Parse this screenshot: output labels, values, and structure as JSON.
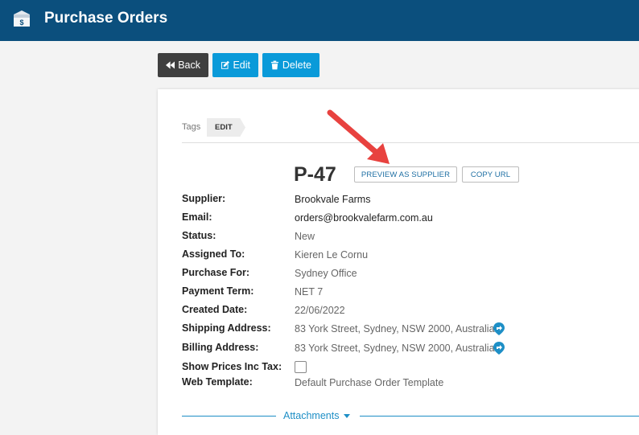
{
  "header": {
    "title": "Purchase Orders",
    "icon": "dollar-box-icon"
  },
  "toolbar": {
    "back_label": "Back",
    "edit_label": "Edit",
    "delete_label": "Delete"
  },
  "tags": {
    "label": "Tags",
    "edit_label": "EDIT"
  },
  "order": {
    "number": "P-47",
    "preview_label": "PREVIEW AS SUPPLIER",
    "copy_url_label": "COPY URL"
  },
  "fields": {
    "supplier": {
      "label": "Supplier:",
      "value": "Brookvale Farms"
    },
    "email": {
      "label": "Email:",
      "value": "orders@brookvalefarm.com.au"
    },
    "status": {
      "label": "Status:",
      "value": "New"
    },
    "assigned_to": {
      "label": "Assigned To:",
      "value": "Kieren Le Cornu"
    },
    "purchase_for": {
      "label": "Purchase For:",
      "value": "Sydney Office"
    },
    "payment_term": {
      "label": "Payment Term:",
      "value": "NET 7"
    },
    "created_date": {
      "label": "Created Date:",
      "value": "22/06/2022"
    },
    "shipping_address": {
      "label": "Shipping Address:",
      "value": "83 York Street, Sydney, NSW 2000, Australia"
    },
    "billing_address": {
      "label": "Billing Address:",
      "value": "83 York Street, Sydney, NSW 2000, Australia"
    },
    "show_prices_inc_tax": {
      "label": "Show Prices Inc Tax:",
      "checked": false
    },
    "web_template": {
      "label": "Web Template:",
      "value": "Default Purchase Order Template"
    }
  },
  "attachments": {
    "label": "Attachments"
  },
  "colors": {
    "header": "#0b4f7d",
    "primary_button": "#0a9ad9",
    "back_button": "#3f3f3f",
    "link": "#1e8fc6",
    "annotation_arrow": "#e8423f"
  }
}
